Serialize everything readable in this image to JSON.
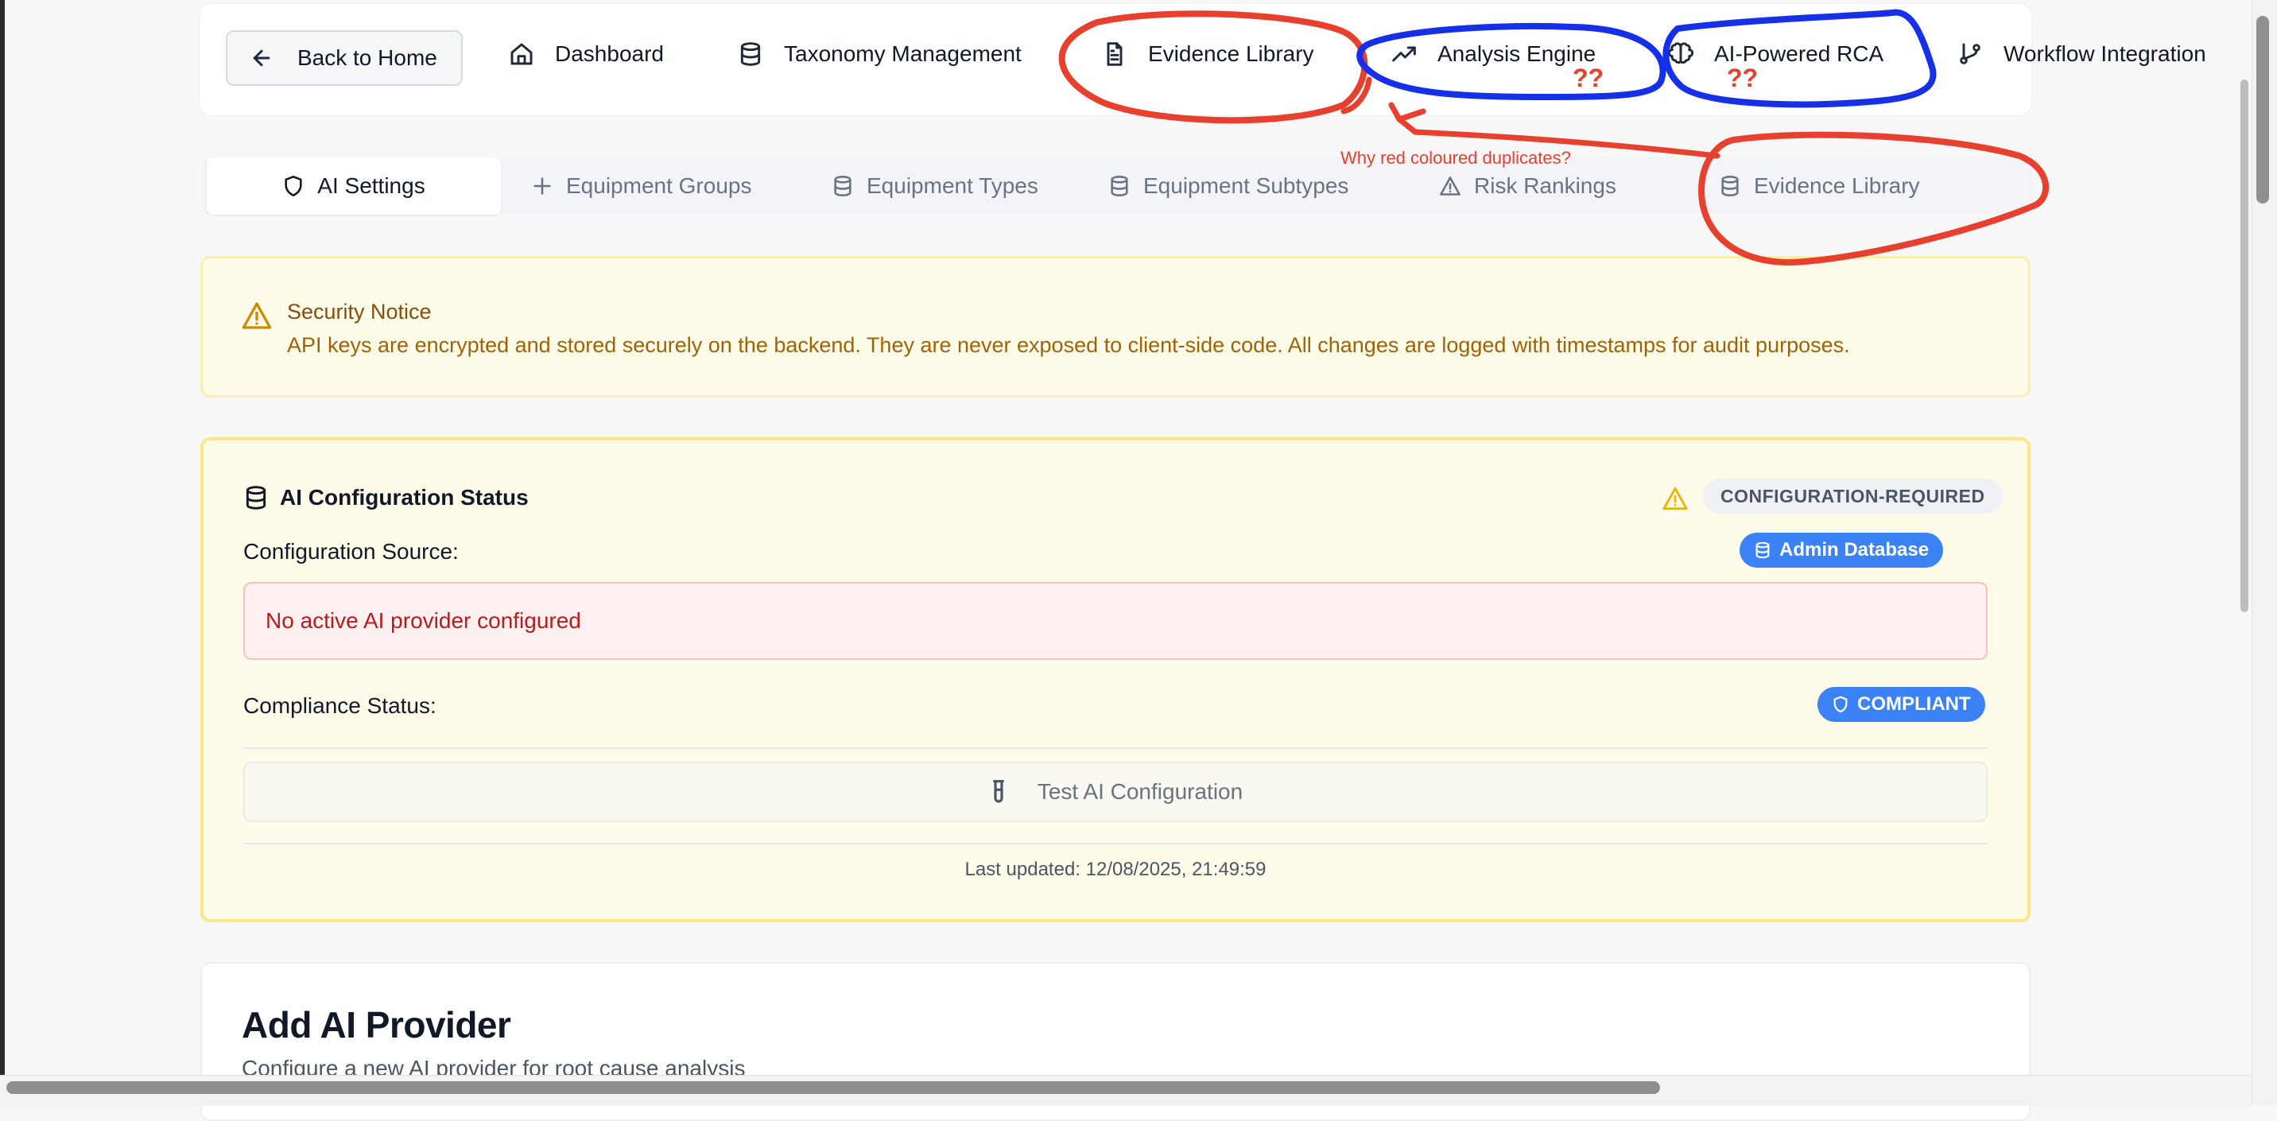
{
  "nav": {
    "back_label": "Back to Home",
    "items": [
      {
        "label": "Dashboard",
        "icon": "home-icon"
      },
      {
        "label": "Taxonomy Management",
        "icon": "database-icon"
      },
      {
        "label": "Evidence Library",
        "icon": "document-icon"
      },
      {
        "label": "Analysis Engine",
        "icon": "trending-up-icon"
      },
      {
        "label": "AI-Powered RCA",
        "icon": "brain-icon"
      },
      {
        "label": "Workflow Integration",
        "icon": "git-branch-icon"
      }
    ]
  },
  "tabs": [
    {
      "label": "AI Settings",
      "icon": "shield-icon",
      "active": true
    },
    {
      "label": "Equipment Groups",
      "icon": "plus-icon"
    },
    {
      "label": "Equipment Types",
      "icon": "database-icon"
    },
    {
      "label": "Equipment Subtypes",
      "icon": "database-icon"
    },
    {
      "label": "Risk Rankings",
      "icon": "warning-icon"
    },
    {
      "label": "Evidence Library",
      "icon": "database-icon"
    }
  ],
  "security": {
    "title": "Security Notice",
    "text": "API keys are encrypted and stored securely on the backend. They are never exposed to client-side code. All changes are logged with timestamps for audit purposes."
  },
  "config": {
    "title": "AI Configuration Status",
    "status": "CONFIGURATION-REQUIRED",
    "source_label": "Configuration Source:",
    "source_badge": "Admin Database",
    "error": "No active AI provider configured",
    "compliance_label": "Compliance Status:",
    "compliance_badge": "COMPLIANT",
    "test_button": "Test AI Configuration",
    "last_updated": "Last updated: 12/08/2025, 21:49:59"
  },
  "add_provider": {
    "title": "Add AI Provider",
    "subtitle": "Configure a new AI provider for root cause analysis"
  },
  "annotations": {
    "question": "Why red coloured duplicates?",
    "marks_1": "??",
    "marks_2": "??",
    "colors": {
      "red": "#e8402f",
      "blue": "#1530e8"
    }
  },
  "colors": {
    "notice_bg": "#fefce8",
    "badge_blue": "#3b82f6",
    "error_text": "#b91c1c"
  }
}
